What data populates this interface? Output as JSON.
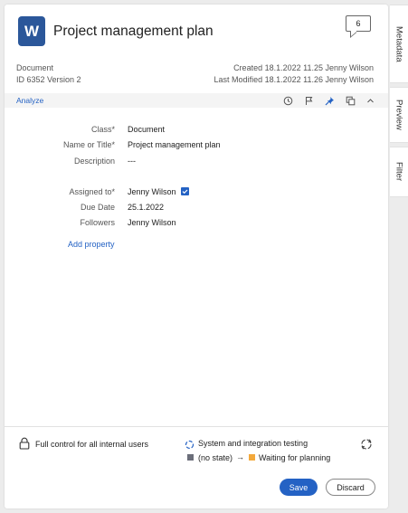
{
  "header": {
    "app_letter": "W",
    "title": "Project management plan",
    "comment_count": "6"
  },
  "meta": {
    "type": "Document",
    "id_version": "ID 6352 Version 2",
    "created": "Created 18.1.2022  11.25 Jenny Wilson",
    "modified": "Last Modified 18.1.2022  11.26 Jenny Wilson"
  },
  "toolbar": {
    "analyze": "Analyze"
  },
  "properties": {
    "class": {
      "label": "Class*",
      "value": "Document"
    },
    "name": {
      "label": "Name or Title*",
      "value": "Project management plan"
    },
    "description": {
      "label": "Description",
      "value": "---"
    },
    "assigned": {
      "label": "Assigned to*",
      "value": "Jenny Wilson"
    },
    "due": {
      "label": "Due Date",
      "value": "25.1.2022"
    },
    "followers": {
      "label": "Followers",
      "value": "Jenny Wilson"
    },
    "add_property": "Add property"
  },
  "footer": {
    "permission": "Full control for all internal users",
    "workflow": "System and integration testing",
    "state_from": "(no state)",
    "state_to": "Waiting for planning",
    "save": "Save",
    "discard": "Discard"
  },
  "side_tabs": [
    "Metadata",
    "Preview",
    "Filter"
  ],
  "colors": {
    "accent": "#2462c4",
    "word": "#2b579a",
    "state_to": "#f3a93c",
    "state_from": "#6b6e7a"
  }
}
